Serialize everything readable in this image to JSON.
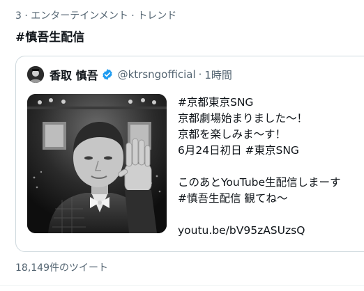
{
  "trend": {
    "context": "3 · エンターテインメント · トレンド",
    "title": "#慎吾生配信"
  },
  "tweet": {
    "author_name": "香取 慎吾",
    "handle": "@ktrsngofficial",
    "separator": "·",
    "time": "1時間",
    "lines": [
      "#京都東京SNG",
      "京都劇場始まりました〜！",
      "京都を楽しみま〜す！",
      "6月24日初日 #東京SNG",
      "",
      "このあとYouTube生配信しまーす",
      "#慎吾生配信 観てね〜",
      "",
      "youtu.be/bV95zASUzsQ"
    ],
    "media_icon": "photo-thumbnail"
  },
  "footer": {
    "tweet_count": "18,149件のツイート"
  },
  "colors": {
    "text_primary": "#0f1419",
    "text_secondary": "#536471",
    "border": "#cfd9de",
    "verified": "#1d9bf0"
  }
}
